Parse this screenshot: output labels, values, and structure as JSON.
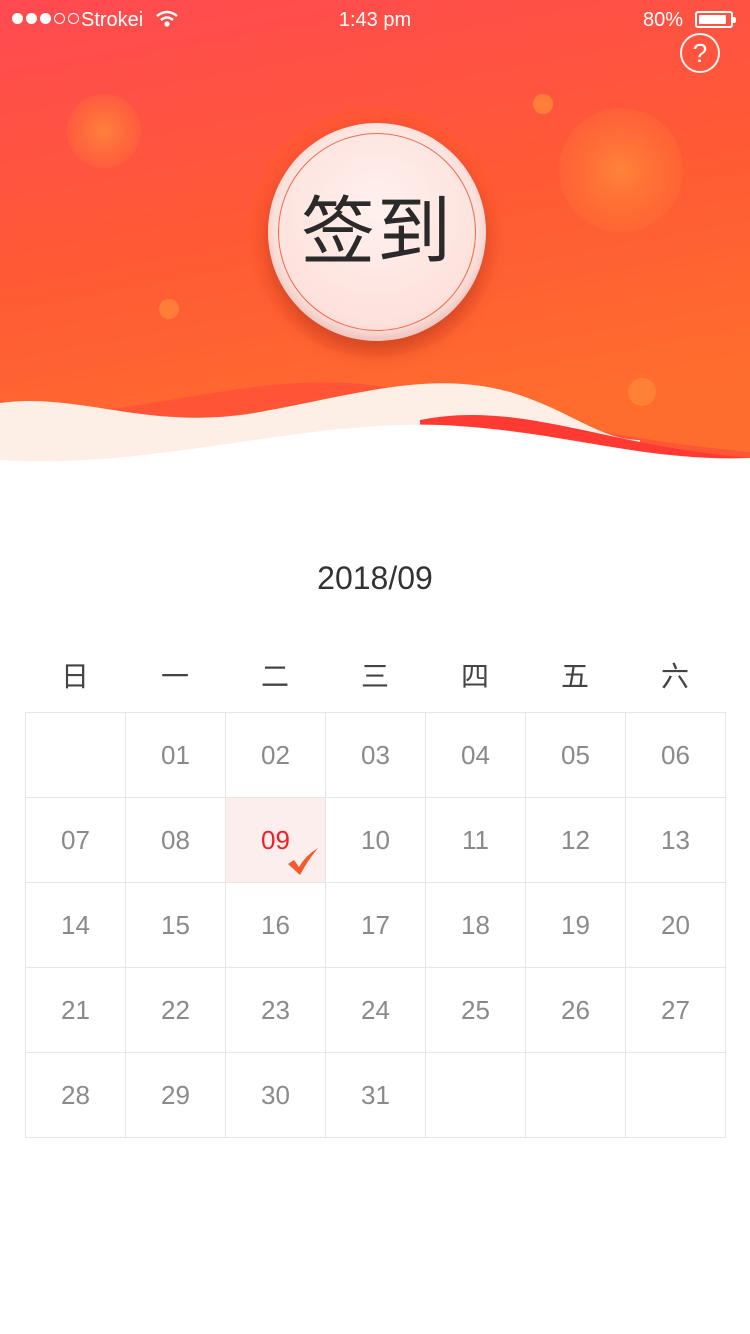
{
  "status_bar": {
    "carrier": "Strokei",
    "time": "1:43 pm",
    "battery": "80%"
  },
  "header": {
    "help_icon": "question-circle-icon",
    "help_label": "?",
    "sign_button_label": "签到",
    "colors": {
      "gradient_top": "#ff4a52",
      "gradient_bottom": "#ff6a33",
      "wave": "#fdeee6"
    }
  },
  "calendar": {
    "month": "2018/09",
    "weekdays": [
      "日",
      "一",
      "二",
      "三",
      "四",
      "五",
      "六"
    ],
    "weeks": [
      [
        "",
        "01",
        "02",
        "03",
        "04",
        "05",
        "06"
      ],
      [
        "07",
        "08",
        "09",
        "10",
        "11",
        "12",
        "13"
      ],
      [
        "14",
        "15",
        "16",
        "17",
        "18",
        "19",
        "20"
      ],
      [
        "21",
        "22",
        "23",
        "24",
        "25",
        "26",
        "27"
      ],
      [
        "28",
        "29",
        "30",
        "31",
        "",
        "",
        ""
      ]
    ],
    "signed_day": "09",
    "signed_icon": "checkmark-icon",
    "colors": {
      "signed_text": "#f0202a",
      "signed_bg": "#fbeeed",
      "check": "#f45a2c"
    }
  }
}
